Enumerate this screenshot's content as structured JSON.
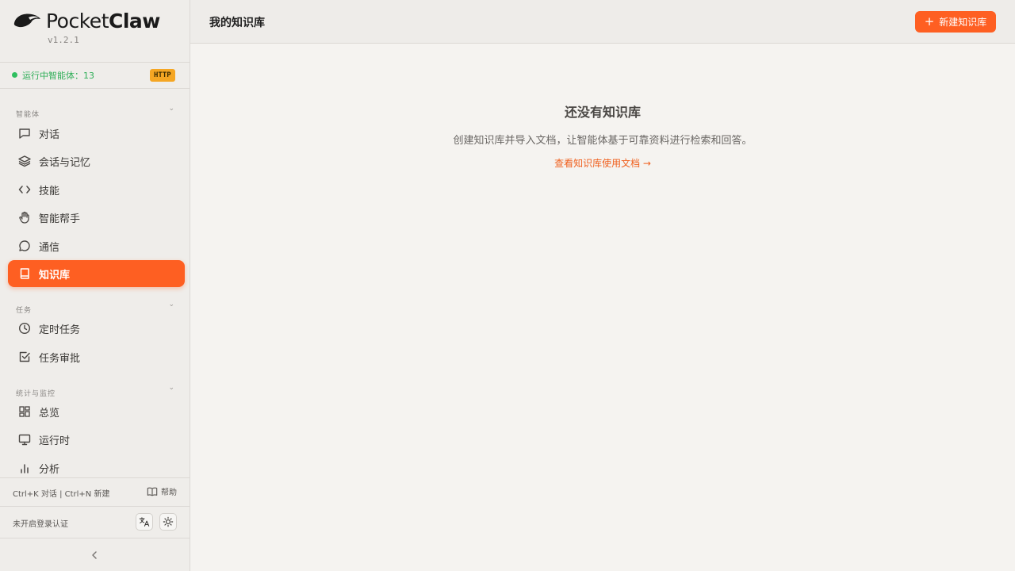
{
  "brand": {
    "name_light": "Pocket",
    "name_bold": "Claw",
    "version": "v1.2.1"
  },
  "status": {
    "text": "运行中智能体：13",
    "badge": "HTTP",
    "dot_color": "#2fbf5f"
  },
  "sections": [
    {
      "title": "智能体",
      "items": [
        {
          "label": "对话",
          "icon": "chat-bubble-icon"
        },
        {
          "label": "会话与记忆",
          "icon": "layers-icon"
        },
        {
          "label": "技能",
          "icon": "code-icon"
        },
        {
          "label": "智能帮手",
          "icon": "hand-icon"
        },
        {
          "label": "通信",
          "icon": "message-circle-icon"
        },
        {
          "label": "知识库",
          "icon": "book-icon",
          "active": true
        }
      ]
    },
    {
      "title": "任务",
      "items": [
        {
          "label": "定时任务",
          "icon": "clock-icon"
        },
        {
          "label": "任务审批",
          "icon": "check-square-icon"
        }
      ]
    },
    {
      "title": "统计与监控",
      "items": [
        {
          "label": "总览",
          "icon": "dashboard-icon"
        },
        {
          "label": "运行时",
          "icon": "monitor-icon"
        },
        {
          "label": "分析",
          "icon": "bar-chart-icon"
        }
      ]
    }
  ],
  "footer": {
    "shortcuts": "Ctrl+K 对话 | Ctrl+N 新建",
    "help_label": "帮助",
    "auth_text": "未开启登录认证"
  },
  "topbar": {
    "title": "我的知识库",
    "new_button": "新建知识库"
  },
  "empty_state": {
    "title": "还没有知识库",
    "description": "创建知识库并导入文档，让智能体基于可靠资料进行检索和回答。",
    "link": "查看知识库使用文档 →"
  },
  "colors": {
    "accent": "#fe5f22",
    "sidebar_bg": "#efedea",
    "main_bg": "#f5f3f0"
  }
}
